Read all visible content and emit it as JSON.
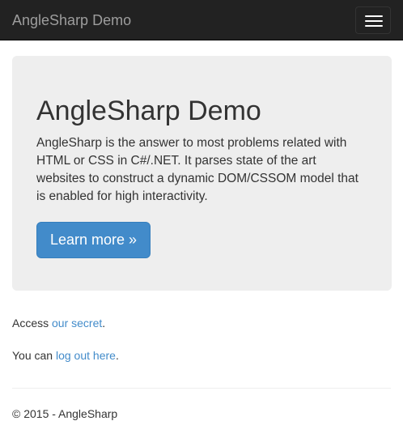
{
  "navbar": {
    "brand": "AngleSharp Demo",
    "toggle_icon": "hamburger-menu-icon",
    "background": "#222222",
    "brand_color": "#9d9d9d"
  },
  "jumbotron": {
    "title": "AngleSharp Demo",
    "lead": "AngleSharp is the answer to most problems related with HTML or CSS in C#/.NET. It parses state of the art websites to construct a dynamic DOM/CSSOM model that is enabled for high interactivity.",
    "button_label": "Learn more »",
    "background": "#eeeeee",
    "button_color": "#428bca"
  },
  "content": {
    "secret": {
      "prefix": "Access ",
      "link": "our secret",
      "suffix": "."
    },
    "logout": {
      "prefix": "You can ",
      "link": "log out here",
      "suffix": "."
    },
    "link_color": "#428bca"
  },
  "footer": {
    "text": "© 2015 - AngleSharp"
  }
}
